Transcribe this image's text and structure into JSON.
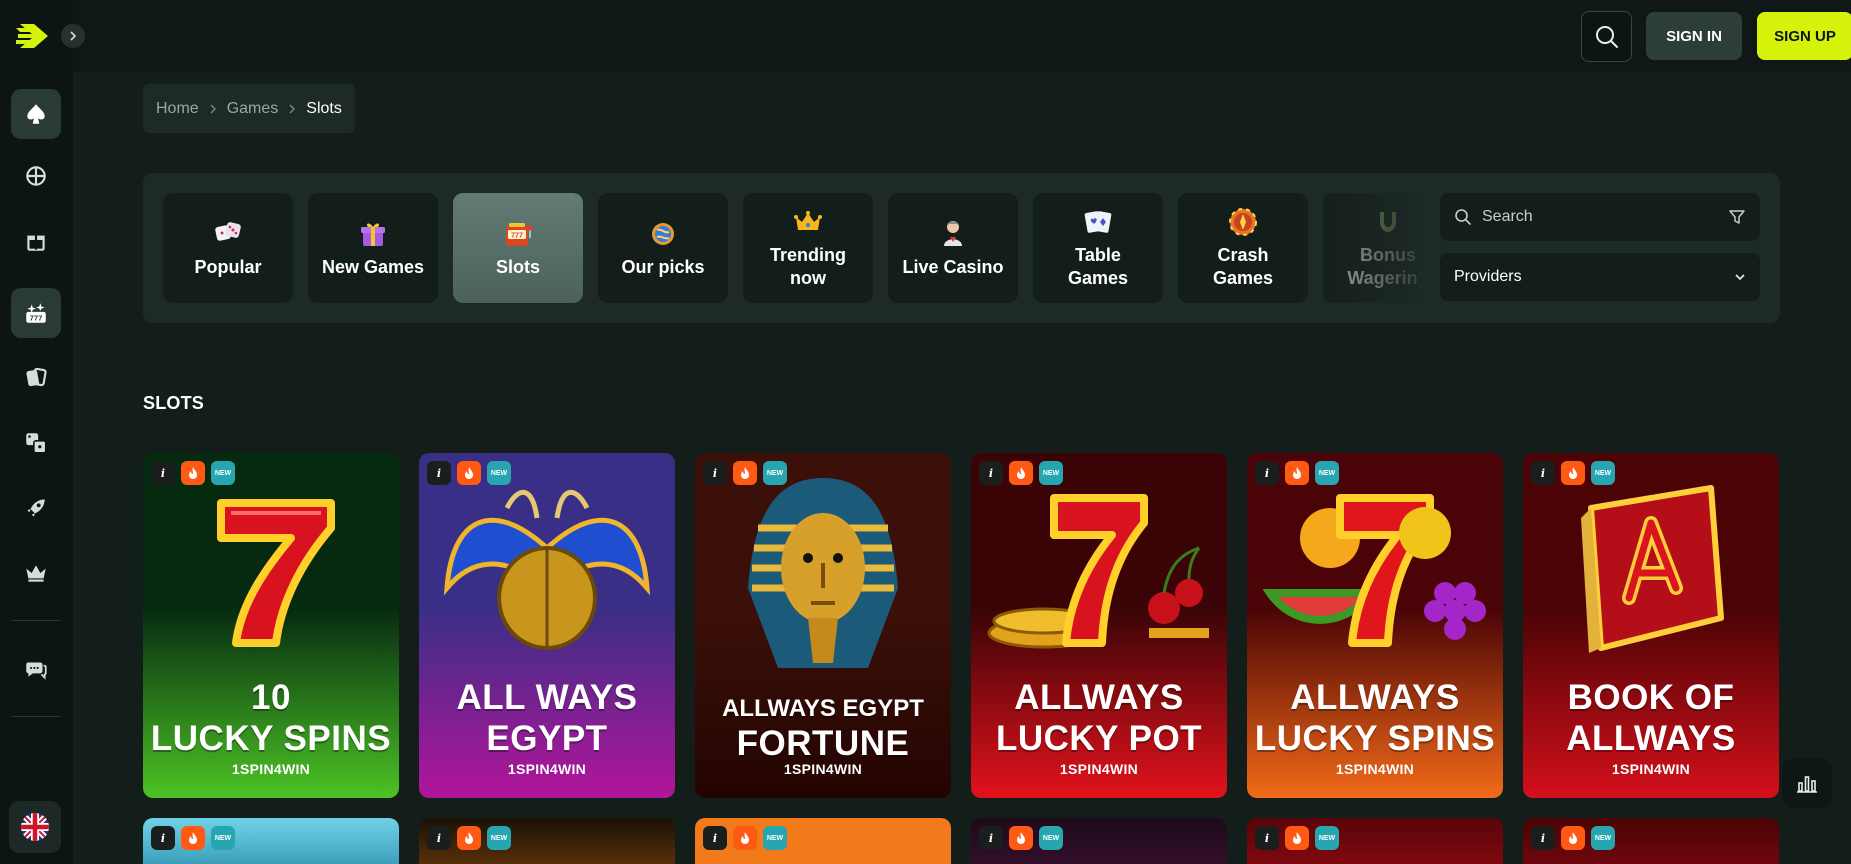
{
  "header": {
    "signin_label": "SIGN IN",
    "signup_label": "SIGN UP"
  },
  "breadcrumb": {
    "items": [
      "Home",
      "Games",
      "Slots"
    ]
  },
  "categories": [
    {
      "label": "Popular",
      "icon": "dice-icon"
    },
    {
      "label": "New Games",
      "icon": "gift-icon"
    },
    {
      "label": "Slots",
      "icon": "slot-machine-icon"
    },
    {
      "label": "Our picks",
      "icon": "planet-icon"
    },
    {
      "label": "Trending now",
      "icon": "crown-icon"
    },
    {
      "label": "Live Casino",
      "icon": "dealer-icon"
    },
    {
      "label": "Table Games",
      "icon": "cards-icon"
    },
    {
      "label": "Crash Games",
      "icon": "chip-icon"
    },
    {
      "label": "Bonus Wagering",
      "icon": "horseshoe-icon"
    }
  ],
  "search": {
    "placeholder": "Search"
  },
  "providers": {
    "label": "Providers"
  },
  "section": {
    "title": "SLOTS"
  },
  "games": [
    {
      "line1": "10",
      "line2": "LUCKY SPINS",
      "provider": "1SPIN4WIN",
      "art": "red-seven",
      "bg_top": "#062a10",
      "bg_bottom": "#4cc325"
    },
    {
      "line1": "ALL WAYS",
      "line2": "EGYPT",
      "provider": "1SPIN4WIN",
      "art": "scarab",
      "bg_top": "#3a2f86",
      "bg_bottom": "#b2159a"
    },
    {
      "line1": "ALLWAYS EGYPT",
      "line2": "FORTUNE",
      "provider": "1SPIN4WIN",
      "art": "pharaoh",
      "bg_top": "#3b1008",
      "bg_bottom": "#240402"
    },
    {
      "line1": "ALLWAYS",
      "line2": "LUCKY POT",
      "provider": "1SPIN4WIN",
      "art": "seven-cherries",
      "bg_top": "#3a0407",
      "bg_bottom": "#e3121c"
    },
    {
      "line1": "ALLWAYS",
      "line2": "LUCKY SPINS",
      "provider": "1SPIN4WIN",
      "art": "seven-fruits",
      "bg_top": "#4a0306",
      "bg_bottom": "#f26a18"
    },
    {
      "line1": "BOOK OF",
      "line2": "ALLWAYS",
      "provider": "1SPIN4WIN",
      "art": "book-a",
      "bg_top": "#4b0305",
      "bg_bottom": "#d4101b"
    }
  ],
  "colors": {
    "accent": "#d4f20a",
    "hot_badge": "#ff5a14",
    "new_badge": "#27a6b1"
  }
}
